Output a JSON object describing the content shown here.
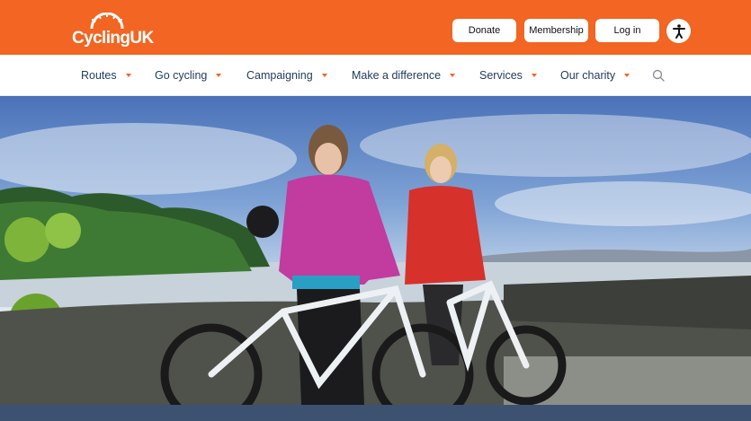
{
  "brand": {
    "name": "CyclingUK",
    "color": "#f26522"
  },
  "header": {
    "donate_label": "Donate",
    "membership_label": "Membership",
    "login_label": "Log in",
    "accessibility_icon": "accessibility-icon"
  },
  "nav": {
    "items": [
      {
        "label": "Routes"
      },
      {
        "label": "Go cycling"
      },
      {
        "label": "Campaigning"
      },
      {
        "label": "Make a difference"
      },
      {
        "label": "Services"
      },
      {
        "label": "Our charity"
      }
    ],
    "search_icon": "search-icon"
  },
  "hero": {
    "image": "two-cyclists-with-bikes-on-shore-photo"
  }
}
